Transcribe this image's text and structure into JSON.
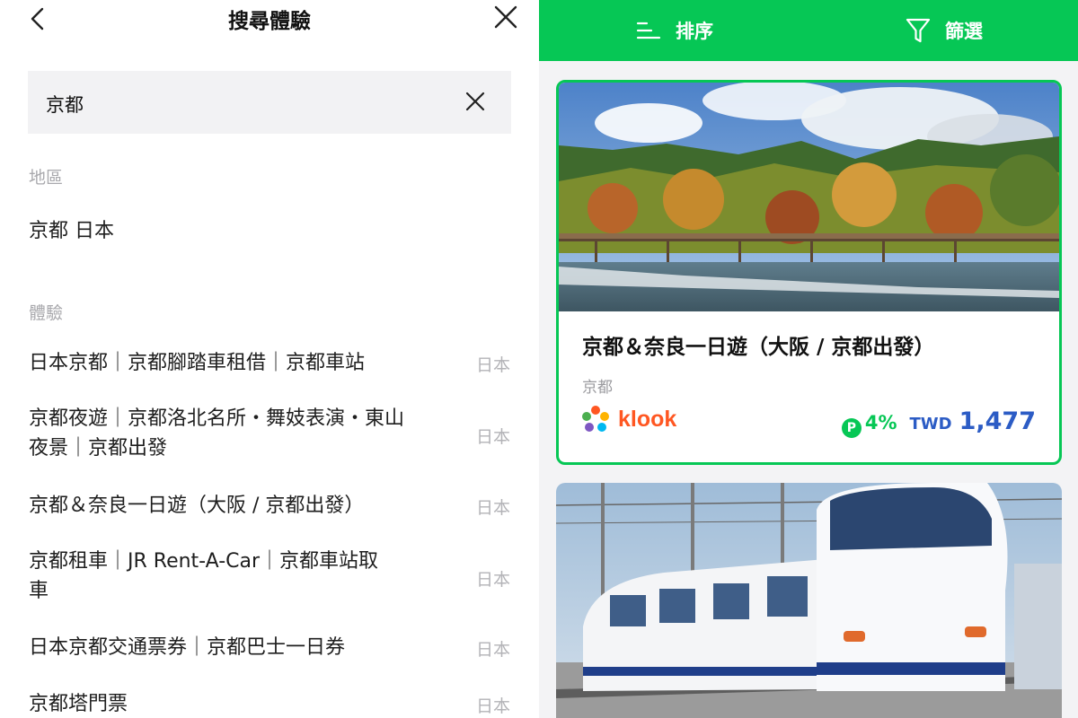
{
  "search_panel": {
    "title": "搜尋體驗",
    "back_icon": "chevron-left-icon",
    "close_icon": "close-icon",
    "search_value": "京都",
    "clear_icon": "close-icon",
    "region_section_label": "地區",
    "region_result": "京都 日本",
    "experience_section_label": "體驗",
    "experiences": [
      {
        "name": "日本京都｜京都腳踏車租借｜京都車站",
        "country": "日本"
      },
      {
        "name": "京都夜遊｜京都洛北名所・舞妓表演・東山夜景｜京都出發",
        "country": "日本"
      },
      {
        "name": "京都＆奈良一日遊（大阪 / 京都出發）",
        "country": "日本"
      },
      {
        "name": "京都租車｜JR Rent-A-Car｜京都車站取車",
        "country": "日本"
      },
      {
        "name": "日本京都交通票券｜京都巴士一日券",
        "country": "日本"
      },
      {
        "name": "京都塔門票",
        "country": "日本"
      }
    ]
  },
  "results_panel": {
    "accent_color": "#06c755",
    "toolbar": {
      "sort_label": "排序",
      "sort_icon": "sort-lines-icon",
      "filter_label": "篩選",
      "filter_icon": "funnel-icon"
    },
    "cards": [
      {
        "title": "京都＆奈良一日遊（大阪 / 京都出發）",
        "region": "京都",
        "provider": "klook",
        "points_badge": "P",
        "points_rate": "4%",
        "currency": "TWD",
        "price": "1,477",
        "price_color": "#2c5cc5"
      }
    ]
  }
}
